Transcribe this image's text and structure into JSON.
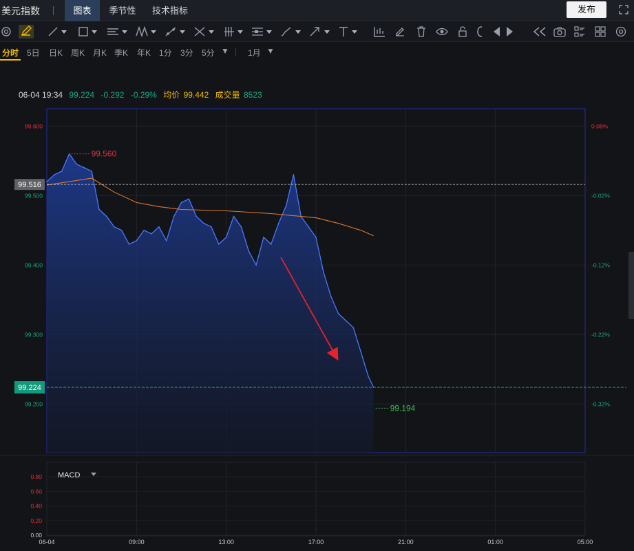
{
  "header": {
    "app_title": "美元指数",
    "tabs": [
      {
        "label": "图表",
        "active": true
      },
      {
        "label": "季节性",
        "active": false
      },
      {
        "label": "技术指标",
        "active": false
      }
    ],
    "publish_label": "发布"
  },
  "toolbar": {
    "icons": [
      "settings-icon",
      "pencil-icon",
      "line-tool-icon",
      "rectangle-tool-icon",
      "parallel-channel-icon",
      "pattern-tool-icon",
      "fib-tool-icon",
      "gann-tool-icon",
      "pitchfork-tool-icon",
      "measure-tool-icon",
      "brush-tool-icon",
      "arrow-tool-icon",
      "text-tool-icon",
      "chart-bars-icon",
      "edit-icon",
      "trash-icon",
      "eye-icon",
      "lock-icon",
      "magnet-icon",
      "prev-icon",
      "next-icon",
      "rewind-icon",
      "camera-icon",
      "list-icon",
      "grid-icon",
      "gear-icon"
    ]
  },
  "periods": [
    {
      "label": "分时",
      "active": true
    },
    {
      "label": "5日"
    },
    {
      "label": "日K"
    },
    {
      "label": "周K"
    },
    {
      "label": "月K"
    },
    {
      "label": "季K"
    },
    {
      "label": "年K"
    },
    {
      "label": "1分"
    },
    {
      "label": "3分"
    },
    {
      "label": "5分"
    },
    {
      "label": "1月"
    }
  ],
  "info": {
    "datetime": "06-04 19:34",
    "price": "99.224",
    "change": "-0.292",
    "change_pct": "-0.29%",
    "avg_label": "均价",
    "avg_value": "99.442",
    "volume_label": "成交量",
    "volume_value": "8523"
  },
  "colors": {
    "price_line": "#4a78ff",
    "avg_line": "#e0782e",
    "up": "#e0313a",
    "down": "#1fa487",
    "avg_text": "#f0b90b",
    "arrow": "#e8212a"
  },
  "chart_data": {
    "type": "area",
    "ylim": [
      99.13,
      99.625
    ],
    "xlim": [
      "06-04",
      "05:00"
    ],
    "y_ticks": [
      "99.600",
      "99.500",
      "99.400",
      "99.300",
      "99.200"
    ],
    "pct_ticks": [
      "0.08%",
      "-0.02%",
      "-0.12%",
      "-0.22%",
      "-0.32%"
    ],
    "x_ticks": [
      "06-04",
      "09:00",
      "13:00",
      "17:00",
      "21:00",
      "01:00",
      "05:00"
    ],
    "ref_price": "99.516",
    "current_price": "99.224",
    "high_label": "99.560",
    "low_label": "99.194",
    "series": [
      {
        "name": "price",
        "x": [
          "05:00",
          "05:20",
          "05:40",
          "06:00",
          "06:20",
          "06:40",
          "07:00",
          "07:20",
          "07:40",
          "08:00",
          "08:20",
          "08:40",
          "09:00",
          "09:20",
          "09:40",
          "10:00",
          "10:20",
          "10:40",
          "11:00",
          "11:20",
          "11:40",
          "12:00",
          "12:20",
          "12:40",
          "13:00",
          "13:20",
          "13:40",
          "14:00",
          "14:20",
          "14:40",
          "15:00",
          "15:20",
          "15:40",
          "16:00",
          "16:20",
          "16:40",
          "17:00",
          "17:20",
          "17:40",
          "18:00",
          "18:20",
          "18:40",
          "19:00",
          "19:20",
          "19:34"
        ],
        "values": [
          99.52,
          99.53,
          99.535,
          99.56,
          99.545,
          99.54,
          99.535,
          99.48,
          99.47,
          99.455,
          99.45,
          99.43,
          99.435,
          99.45,
          99.445,
          99.455,
          99.435,
          99.47,
          99.49,
          99.495,
          99.47,
          99.46,
          99.455,
          99.43,
          99.44,
          99.47,
          99.455,
          99.42,
          99.4,
          99.44,
          99.43,
          99.46,
          99.485,
          99.53,
          99.47,
          99.455,
          99.44,
          99.39,
          99.355,
          99.33,
          99.32,
          99.31,
          99.275,
          99.24,
          99.224
        ]
      },
      {
        "name": "average",
        "x": [
          "05:00",
          "06:00",
          "07:00",
          "08:00",
          "09:00",
          "10:00",
          "11:00",
          "12:00",
          "13:00",
          "14:00",
          "15:00",
          "16:00",
          "17:00",
          "18:00",
          "19:00",
          "19:34"
        ],
        "values": [
          99.515,
          99.52,
          99.525,
          99.505,
          99.49,
          99.484,
          99.48,
          99.479,
          99.478,
          99.476,
          99.474,
          99.471,
          99.468,
          99.46,
          99.45,
          99.442
        ]
      }
    ],
    "macd": {
      "label": "MACD",
      "y_ticks": [
        "0.80",
        "0.60",
        "0.40",
        "0.20",
        "0.00"
      ]
    }
  }
}
